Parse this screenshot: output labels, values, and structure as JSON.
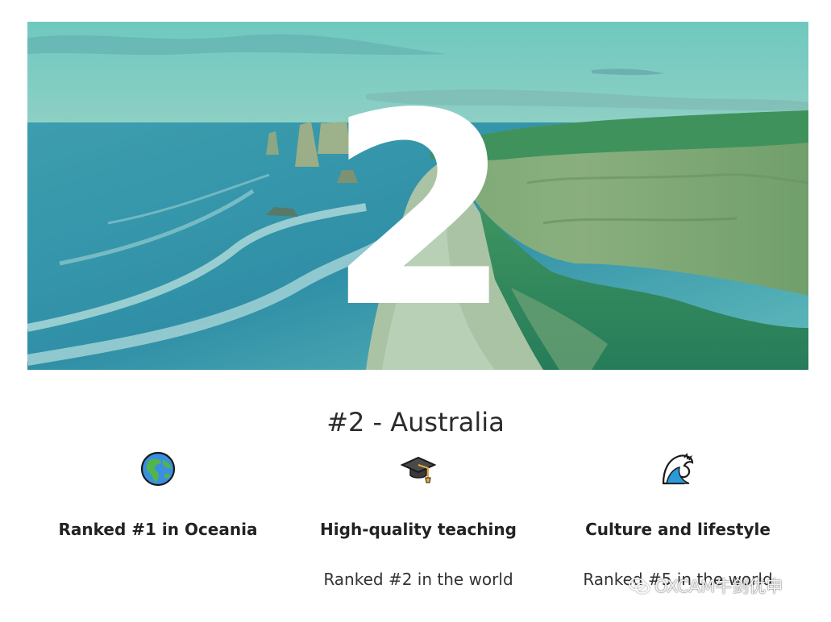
{
  "hero": {
    "big_number": "2"
  },
  "section": {
    "title": "#2 - Australia"
  },
  "features": [
    {
      "icon": "globe-africa-europe-icon",
      "heading": "Ranked #1 in Oceania",
      "text": ""
    },
    {
      "icon": "graduation-cap-icon",
      "heading": "High-quality teaching",
      "text": "Ranked #2 in the world"
    },
    {
      "icon": "water-wave-icon",
      "heading": "Culture and lifestyle",
      "text": "Ranked #5 in the world"
    }
  ],
  "watermark": {
    "text": "OXCAM牛剑优申"
  },
  "colors": {
    "hero_overlay": "#4fb3a5",
    "title_text": "#2b2b2b",
    "heading_text": "#222222"
  }
}
